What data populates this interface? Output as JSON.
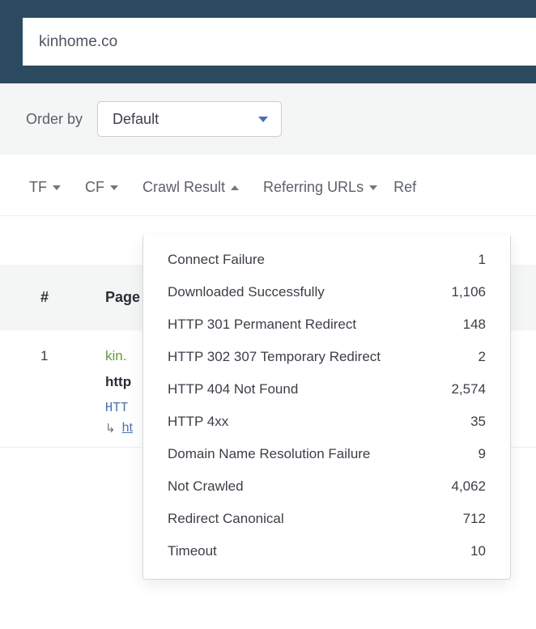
{
  "search": {
    "value": "kinhome.co"
  },
  "orderby": {
    "label": "Order by",
    "selected": "Default"
  },
  "columns": {
    "tf": "TF",
    "cf": "CF",
    "crawl_result": "Crawl Result",
    "referring_urls": "Referring URLs",
    "ref_partial": "Ref"
  },
  "table": {
    "header": {
      "hash": "#",
      "page": "Page"
    },
    "rows": [
      {
        "idx": "1",
        "domain": "kin.",
        "url_label": "http",
        "http_label": "HTT",
        "redir_label": "ht"
      }
    ]
  },
  "crawl_result_menu": [
    {
      "label": "Connect Failure",
      "count": "1"
    },
    {
      "label": "Downloaded Successfully",
      "count": "1,106"
    },
    {
      "label": "HTTP 301 Permanent Redirect",
      "count": "148"
    },
    {
      "label": "HTTP 302 307 Temporary Redirect",
      "count": "2"
    },
    {
      "label": "HTTP 404 Not Found",
      "count": "2,574"
    },
    {
      "label": "HTTP 4xx",
      "count": "35"
    },
    {
      "label": "Domain Name Resolution Failure",
      "count": "9"
    },
    {
      "label": "Not Crawled",
      "count": "4,062"
    },
    {
      "label": "Redirect Canonical",
      "count": "712"
    },
    {
      "label": "Timeout",
      "count": "10"
    }
  ]
}
